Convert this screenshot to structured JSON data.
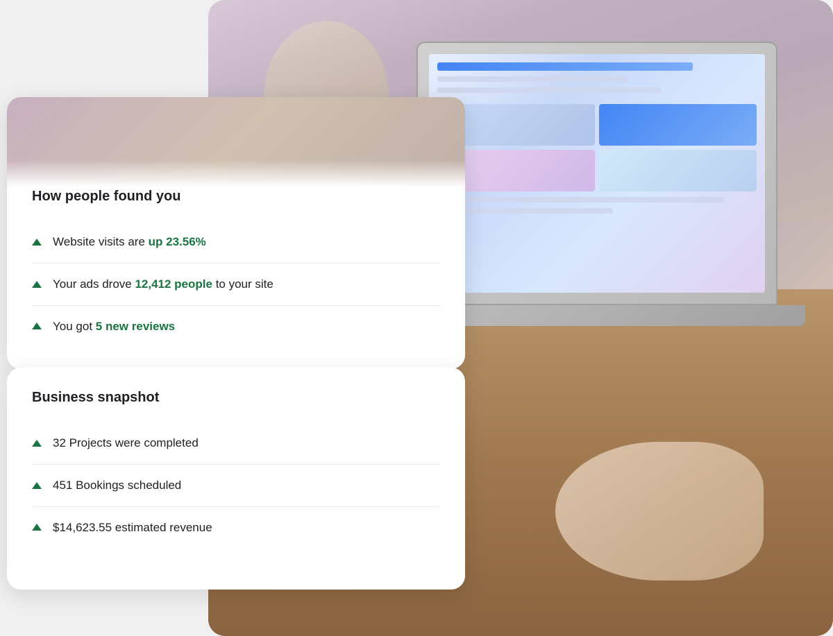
{
  "scene": {
    "background_color": "#f0f0f0"
  },
  "card_top": {
    "title": "How people found you",
    "stats": [
      {
        "id": "website-visits",
        "prefix": "Website visits are ",
        "highlight": "up 23.56%",
        "suffix": ""
      },
      {
        "id": "ads-drove",
        "prefix": "Your ads drove ",
        "highlight": "12,412 people",
        "suffix": " to your site"
      },
      {
        "id": "new-reviews",
        "prefix": "You got ",
        "highlight": "5 new reviews",
        "suffix": ""
      }
    ]
  },
  "card_bottom": {
    "title": "Business snapshot",
    "stats": [
      {
        "id": "projects-completed",
        "prefix": "32 Projects were completed",
        "highlight": "",
        "suffix": ""
      },
      {
        "id": "bookings-scheduled",
        "prefix": "451 Bookings scheduled",
        "highlight": "",
        "suffix": ""
      },
      {
        "id": "estimated-revenue",
        "prefix": "$14,623.55 estimated revenue",
        "highlight": "",
        "suffix": ""
      }
    ]
  },
  "colors": {
    "accent_green": "#1a7340",
    "text_dark": "#202124",
    "divider": "#e8eaed",
    "card_bg": "#ffffff"
  }
}
